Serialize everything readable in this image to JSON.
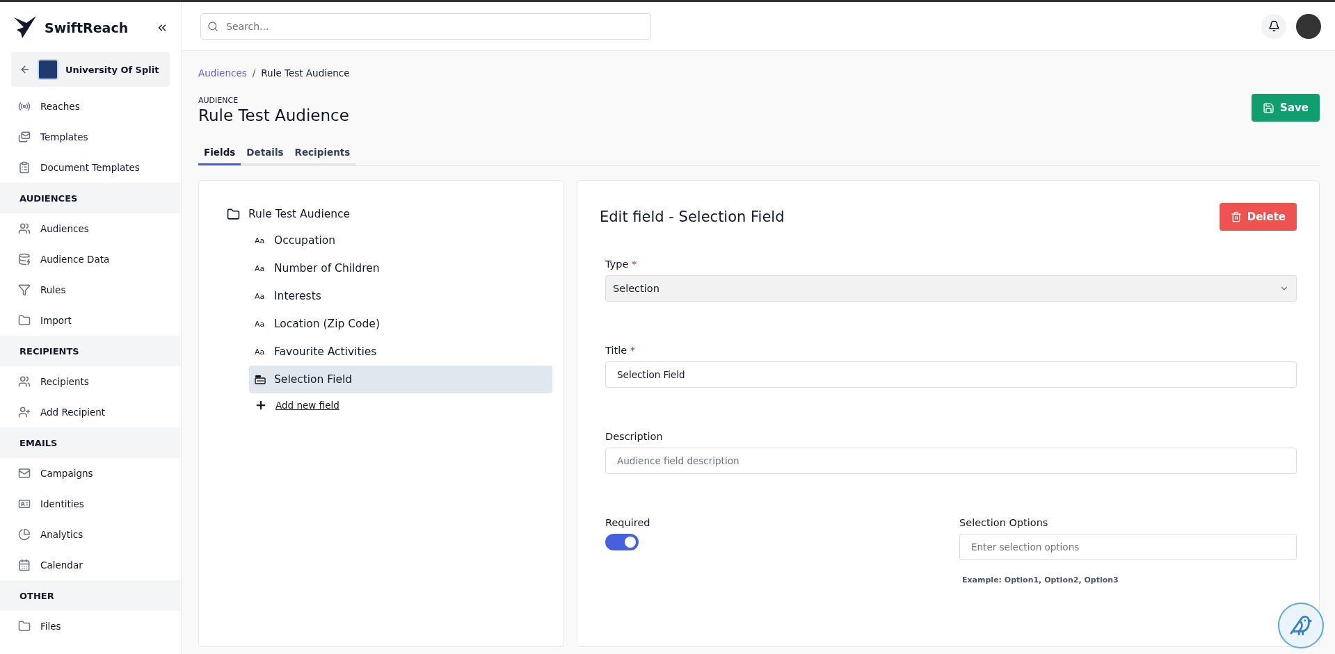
{
  "brand": {
    "name": "SwiftReach"
  },
  "organization": {
    "name": "University Of Split"
  },
  "sidebar": {
    "items": [
      {
        "kind": "item",
        "label": "Reaches"
      },
      {
        "kind": "item",
        "label": "Templates"
      },
      {
        "kind": "item",
        "label": "Document Templates"
      },
      {
        "kind": "heading",
        "label": "AUDIENCES"
      },
      {
        "kind": "item",
        "label": "Audiences"
      },
      {
        "kind": "item",
        "label": "Audience Data"
      },
      {
        "kind": "item",
        "label": "Rules"
      },
      {
        "kind": "item",
        "label": "Import"
      },
      {
        "kind": "heading",
        "label": "RECIPIENTS"
      },
      {
        "kind": "item",
        "label": "Recipients"
      },
      {
        "kind": "item",
        "label": "Add Recipient"
      },
      {
        "kind": "heading",
        "label": "EMAILS"
      },
      {
        "kind": "item",
        "label": "Campaigns"
      },
      {
        "kind": "item",
        "label": "Identities"
      },
      {
        "kind": "item",
        "label": "Analytics"
      },
      {
        "kind": "item",
        "label": "Calendar"
      },
      {
        "kind": "heading",
        "label": "OTHER"
      },
      {
        "kind": "item",
        "label": "Files"
      }
    ]
  },
  "search": {
    "placeholder": "Search..."
  },
  "breadcrumb": [
    {
      "label": "Audiences",
      "kind": "link"
    },
    {
      "label": "Rule Test Audience",
      "kind": "current"
    }
  ],
  "breadcrumb_separator": "/",
  "page": {
    "overline": "AUDIENCE",
    "title": "Rule Test Audience",
    "save_label": "Save"
  },
  "tabs": [
    {
      "label": "Fields",
      "selected": true
    },
    {
      "label": "Details",
      "selected": false
    },
    {
      "label": "Recipients",
      "selected": false
    }
  ],
  "tree": {
    "root": "Rule Test Audience",
    "children": [
      {
        "kind": "text",
        "icon_text": "Aa",
        "label": "Occupation",
        "selected": false
      },
      {
        "kind": "text",
        "icon_text": "Aa",
        "label": "Number of Children",
        "selected": false
      },
      {
        "kind": "text",
        "icon_text": "Aa",
        "label": "Interests",
        "selected": false
      },
      {
        "kind": "text",
        "icon_text": "Aa",
        "label": "Location (Zip Code)",
        "selected": false
      },
      {
        "kind": "text",
        "icon_text": "Aa",
        "label": "Favourite Activities",
        "selected": false
      },
      {
        "kind": "selection",
        "label": "Selection Field",
        "selected": true
      }
    ],
    "add_label": "Add new field"
  },
  "editor": {
    "title": "Edit field - Selection Field",
    "delete_label": "Delete",
    "type": {
      "label": "Type",
      "required_mark": "*",
      "value": "Selection"
    },
    "field_title": {
      "label": "Title",
      "required_mark": "*",
      "value": "Selection Field"
    },
    "description": {
      "label": "Description",
      "placeholder": "Audience field description"
    },
    "required": {
      "label": "Required",
      "on": true
    },
    "options": {
      "label": "Selection Options",
      "placeholder": "Enter selection options",
      "hint": "Example: Option1, Option2, Option3"
    }
  }
}
